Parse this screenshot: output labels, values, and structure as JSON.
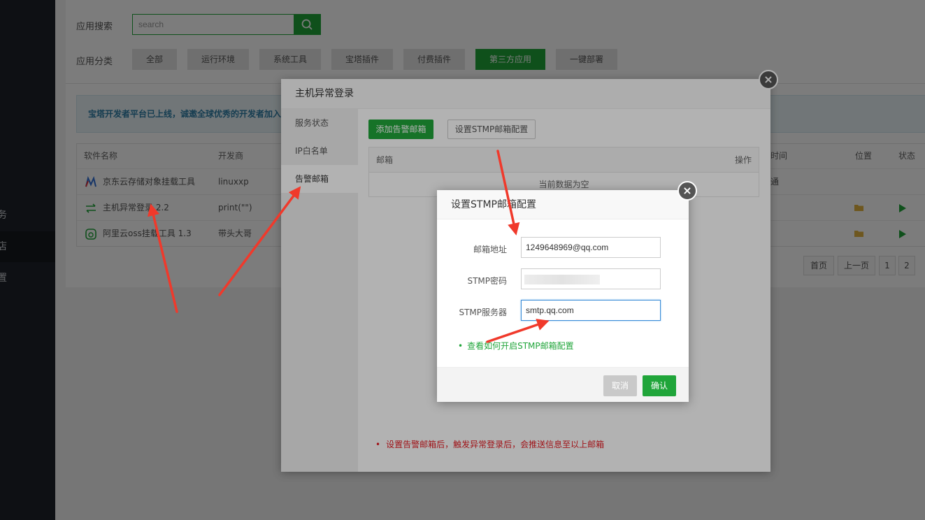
{
  "sidebar": {
    "items": [
      {
        "label": "务"
      },
      {
        "label": "店"
      },
      {
        "label": "置"
      }
    ]
  },
  "page": {
    "search_label": "应用搜索",
    "search_placeholder": "search",
    "category_label": "应用分类",
    "categories": [
      "全部",
      "运行环境",
      "系统工具",
      "宝塔插件",
      "付费插件",
      "第三方应用",
      "一键部署"
    ],
    "active_category": "第三方应用",
    "notice": "宝塔开发者平台已上线，诚邀全球优秀的开发者加入"
  },
  "table": {
    "headers": {
      "name": "软件名称",
      "dev": "开发商",
      "time": "时间",
      "location": "位置",
      "status": "状态"
    },
    "rows": [
      {
        "name": "京东云存储对象挂载工具",
        "dev": "linuxxp",
        "time": "通"
      },
      {
        "name": "主机异常登录 2.2",
        "dev": "print(\"\")",
        "time": ""
      },
      {
        "name": "阿里云oss挂载工具 1.3",
        "dev": "带头大哥",
        "time": ""
      }
    ]
  },
  "pager": {
    "first": "首页",
    "prev": "上一页",
    "p1": "1",
    "p2": "2"
  },
  "dialog1": {
    "title": "主机异常登录",
    "tabs": [
      "服务状态",
      "IP白名单",
      "告警邮箱"
    ],
    "active_tab": "告警邮箱",
    "add_button": "添加告警邮箱",
    "stmp_button": "设置STMP邮箱配置",
    "col_email": "邮箱",
    "col_action": "操作",
    "empty_text": "当前数据为空",
    "note": "设置告警邮箱后，触发异常登录后，会推送信息至以上邮箱"
  },
  "dialog2": {
    "title": "设置STMP邮箱配置",
    "email_label": "邮箱地址",
    "email_value": "1249648969@qq.com",
    "password_label": "STMP密码",
    "server_label": "STMP服务器",
    "server_value": "smtp.qq.com",
    "help_link": "查看如何开启STMP邮箱配置",
    "cancel": "取消",
    "confirm": "确认"
  },
  "colors": {
    "brand_green": "#20a53a",
    "sidebar": "#1f232a",
    "annotation_red": "#f0392b"
  }
}
